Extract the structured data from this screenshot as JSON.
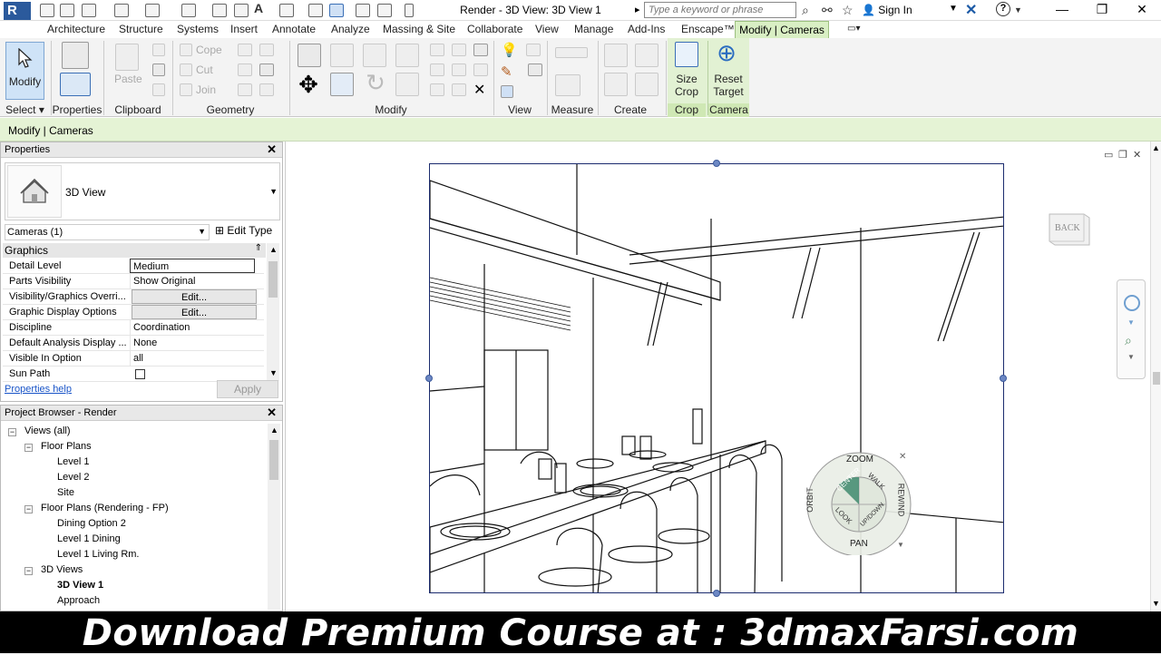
{
  "window": {
    "title": "Render - 3D View: 3D View 1",
    "search_placeholder": "Type a keyword or phrase",
    "sign_in": "Sign In",
    "app_logo": "R"
  },
  "ribbon_tabs": [
    "Architecture",
    "Structure",
    "Systems",
    "Insert",
    "Annotate",
    "Analyze",
    "Massing & Site",
    "Collaborate",
    "View",
    "Manage",
    "Add-Ins",
    "Enscape™",
    "Modify | Cameras"
  ],
  "ribbon": {
    "modify_label": "Modify",
    "properties_label": "Properties",
    "paste_label": "Paste",
    "cope_label": "Cope",
    "cut_label": "Cut",
    "join_label": "Join",
    "size_crop_label": [
      "Size",
      "Crop"
    ],
    "reset_target_label": [
      "Reset",
      "Target"
    ],
    "panels": {
      "select": "Select",
      "properties": "Properties",
      "clipboard": "Clipboard",
      "geometry": "Geometry",
      "modify": "Modify",
      "view": "View",
      "measure": "Measure",
      "create": "Create",
      "crop": "Crop",
      "camera": "Camera"
    }
  },
  "options_bar": {
    "context": "Modify | Cameras"
  },
  "properties": {
    "title": "Properties",
    "type_name": "3D View",
    "instance_filter": "Cameras (1)",
    "edit_type": "Edit Type",
    "group": "Graphics",
    "rows": [
      {
        "name": "Detail Level",
        "value": "Medium"
      },
      {
        "name": "Parts Visibility",
        "value": "Show Original"
      },
      {
        "name": "Visibility/Graphics Overri...",
        "value": "Edit..."
      },
      {
        "name": "Graphic Display Options",
        "value": "Edit..."
      },
      {
        "name": "Discipline",
        "value": "Coordination"
      },
      {
        "name": "Default Analysis Display ...",
        "value": "None"
      },
      {
        "name": "Visible In Option",
        "value": "all"
      },
      {
        "name": "Sun Path",
        "value": ""
      }
    ],
    "help_link": "Properties help",
    "apply": "Apply"
  },
  "browser": {
    "title": "Project Browser - Render",
    "items": [
      {
        "label": "Views (all)",
        "depth": 0,
        "toggle": "−"
      },
      {
        "label": "Floor Plans",
        "depth": 1,
        "toggle": "−"
      },
      {
        "label": "Level 1",
        "depth": 2,
        "toggle": ""
      },
      {
        "label": "Level 2",
        "depth": 2,
        "toggle": ""
      },
      {
        "label": "Site",
        "depth": 2,
        "toggle": ""
      },
      {
        "label": "Floor Plans (Rendering - FP)",
        "depth": 1,
        "toggle": "−"
      },
      {
        "label": "Dining Option 2",
        "depth": 2,
        "toggle": ""
      },
      {
        "label": "Level 1 Dining",
        "depth": 2,
        "toggle": ""
      },
      {
        "label": "Level 1 Living Rm.",
        "depth": 2,
        "toggle": ""
      },
      {
        "label": "3D Views",
        "depth": 1,
        "toggle": "−"
      },
      {
        "label": "3D View 1",
        "depth": 2,
        "toggle": "",
        "bold": true
      },
      {
        "label": "Approach",
        "depth": 2,
        "toggle": ""
      }
    ]
  },
  "viewcube": {
    "face": "BACK"
  },
  "steering_wheel": {
    "zoom": "ZOOM",
    "center": "CENTER",
    "walk": "WALK",
    "rewind": "REWIND",
    "orbit": "ORBIT",
    "look": "LOOK",
    "updown": "UP/DOWN",
    "pan": "PAN"
  },
  "banner": {
    "text": "Download Premium Course at : 3dmaxFarsi.com"
  },
  "colors": {
    "accent": "#d9efc4",
    "brand": "#2b5a9c",
    "link": "#1a55c8"
  }
}
